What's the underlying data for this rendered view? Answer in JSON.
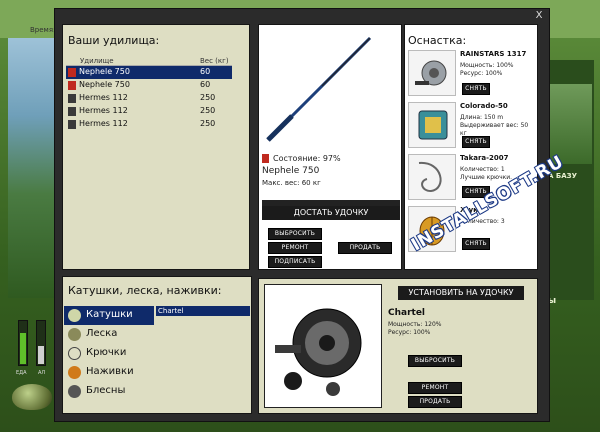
{
  "window": {
    "close": "X"
  },
  "background": {
    "left_label": "Время:",
    "right_text_1": "А БАЗУ",
    "right_text_2": "ы",
    "meter_labels": [
      "ЕДА",
      "АЛ"
    ]
  },
  "rods": {
    "title": "Ваши удилища:",
    "headers": [
      "Удилище",
      "Вес (кг)"
    ],
    "rows": [
      {
        "name": "Nephele 750",
        "weight": "60"
      },
      {
        "name": "Nephele 750",
        "weight": "60"
      },
      {
        "name": "Hermes 112",
        "weight": "250"
      },
      {
        "name": "Hermes 112",
        "weight": "250"
      },
      {
        "name": "Hermes 112",
        "weight": "250"
      }
    ]
  },
  "rod_detail": {
    "status": "Состояние: 97%",
    "name": "Nephele 750",
    "max_weight": "Макс. вес: 60 кг",
    "btn_get": "ДОСТАТЬ УДОЧКУ",
    "btn_throw": "ВЫБРОСИТЬ",
    "btn_repair": "РЕМОНТ",
    "btn_sell": "ПРОДАТЬ",
    "btn_sign": "ПОДПИСАТЬ"
  },
  "osnastka": {
    "title": "Оснастка:",
    "items": [
      {
        "name": "RAINSTARS 1317",
        "desc": [
          "Мощность: 100%",
          "Ресурс: 100%"
        ],
        "btn": "СНЯТЬ"
      },
      {
        "name": "Colorado-50",
        "desc": [
          "Длина: 150 m",
          "Выдерживает вес: 50 кг"
        ],
        "btn": "СНЯТЬ"
      },
      {
        "name": "Takara-2007",
        "desc": [
          "Количество: 1",
          "Лучшие крючки."
        ],
        "btn": "СНЯТЬ"
      },
      {
        "name": "Жук",
        "desc": [
          "Количество: 3"
        ],
        "btn": "СНЯТЬ"
      }
    ]
  },
  "categories": {
    "title": "Катушки, леска, наживки:",
    "items": [
      "Катушки",
      "Леска",
      "Крючки",
      "Наживки",
      "Блесны"
    ],
    "list_item": "Chartel"
  },
  "reel": {
    "btn_install": "УСТАНОВИТЬ НА УДОЧКУ",
    "name": "Chartel",
    "desc": [
      "Мощность: 120%",
      "Ресурс: 100%"
    ],
    "btn_throw": "ВЫБРОСИТЬ",
    "btn_repair": "РЕМОНТ",
    "btn_sell": "ПРОДАТЬ"
  },
  "watermark": "INSTALLSOFT.RU"
}
